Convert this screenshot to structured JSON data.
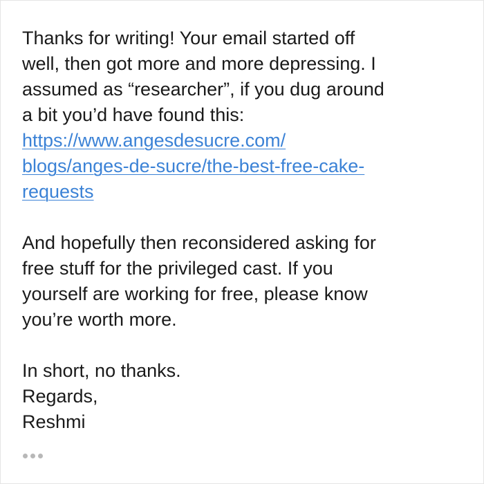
{
  "message": {
    "paragraph_1": [
      "Thanks for writing! Your email started off",
      "well, then got more and more depressing. I",
      "assumed as “researcher”, if you dug around",
      "a bit you’d have found this:"
    ],
    "link": {
      "lines": [
        "https://www.angesdesucre.com/",
        "blogs/anges-de-sucre/the-best-free-cake-",
        "requests"
      ],
      "color": "#3b82d6"
    },
    "paragraph_2": [
      "And hopefully then reconsidered asking for",
      "free stuff for the privileged cast. If you",
      "yourself are working for free, please know",
      "you’re worth more."
    ],
    "closing": {
      "line_1": "In short, no thanks.",
      "line_2": "Regards,",
      "signature": "Reshmi"
    }
  },
  "more_options": {
    "icon": "ellipsis-icon"
  }
}
